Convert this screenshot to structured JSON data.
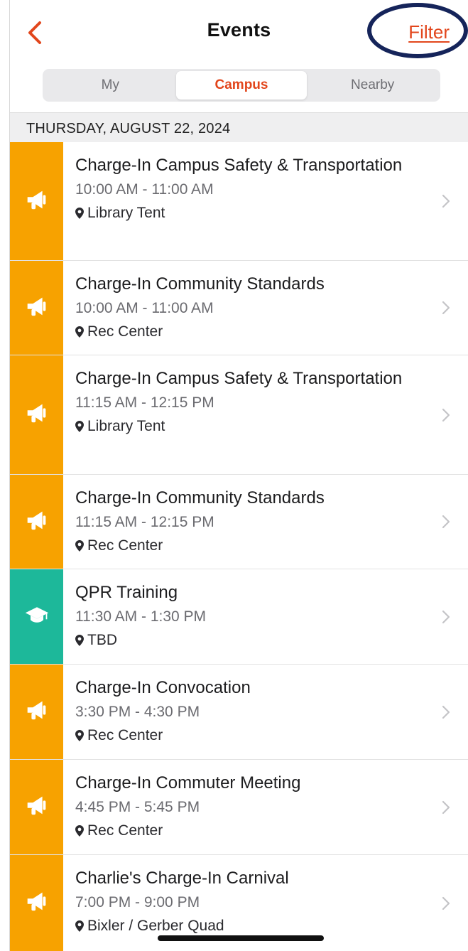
{
  "header": {
    "title": "Events",
    "filter_label": "Filter",
    "back_icon": "chevron-left-icon",
    "accent_color": "#e2461c",
    "annotation_color": "#15245a"
  },
  "segments": [
    {
      "label": "My",
      "active": false
    },
    {
      "label": "Campus",
      "active": true
    },
    {
      "label": "Nearby",
      "active": false
    }
  ],
  "date_header": "THURSDAY, AUGUST 22, 2024",
  "category_colors": {
    "megaphone": "#f7a200",
    "graduation-cap": "#1db89a"
  },
  "events": [
    {
      "title": "Charge-In Campus Safety & Transportation",
      "time": "10:00 AM - 11:00 AM",
      "location": "Library Tent",
      "icon": "megaphone"
    },
    {
      "title": "Charge-In Community Standards",
      "time": "10:00 AM - 11:00 AM",
      "location": "Rec Center",
      "icon": "megaphone"
    },
    {
      "title": "Charge-In Campus Safety & Transportation",
      "time": "11:15 AM - 12:15 PM",
      "location": "Library Tent",
      "icon": "megaphone"
    },
    {
      "title": "Charge-In Community Standards",
      "time": "11:15 AM - 12:15 PM",
      "location": "Rec Center",
      "icon": "megaphone"
    },
    {
      "title": "QPR Training",
      "time": "11:30 AM - 1:30 PM",
      "location": "TBD",
      "icon": "graduation-cap"
    },
    {
      "title": "Charge-In Convocation",
      "time": "3:30 PM - 4:30 PM",
      "location": "Rec Center",
      "icon": "megaphone"
    },
    {
      "title": "Charge-In Commuter Meeting",
      "time": "4:45 PM - 5:45 PM",
      "location": "Rec Center",
      "icon": "megaphone"
    },
    {
      "title": "Charlie's Charge-In Carnival",
      "time": "7:00 PM - 9:00 PM",
      "location": "Bixler / Gerber Quad",
      "icon": "megaphone"
    }
  ]
}
